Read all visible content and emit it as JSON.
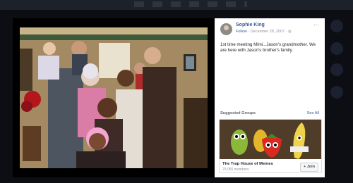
{
  "post": {
    "author": "Sophie King",
    "follow_label": "Follow",
    "separator": " · ",
    "date": "December 28, 2007",
    "privacy_glyph": " · ◍",
    "more_glyph": "···",
    "text": "1st time meeting Mimi...Jason's grandmother. We are here with Jason's brother's family."
  },
  "suggested": {
    "header": "Suggested Groups",
    "see_all": "See All",
    "group": {
      "name": "The Trap House of Memes",
      "members": "23,056 members",
      "join_label": "+ Join"
    }
  },
  "colors": {
    "link": "#385898",
    "backdrop": "#0c0e14",
    "panel": "#ffffff"
  }
}
